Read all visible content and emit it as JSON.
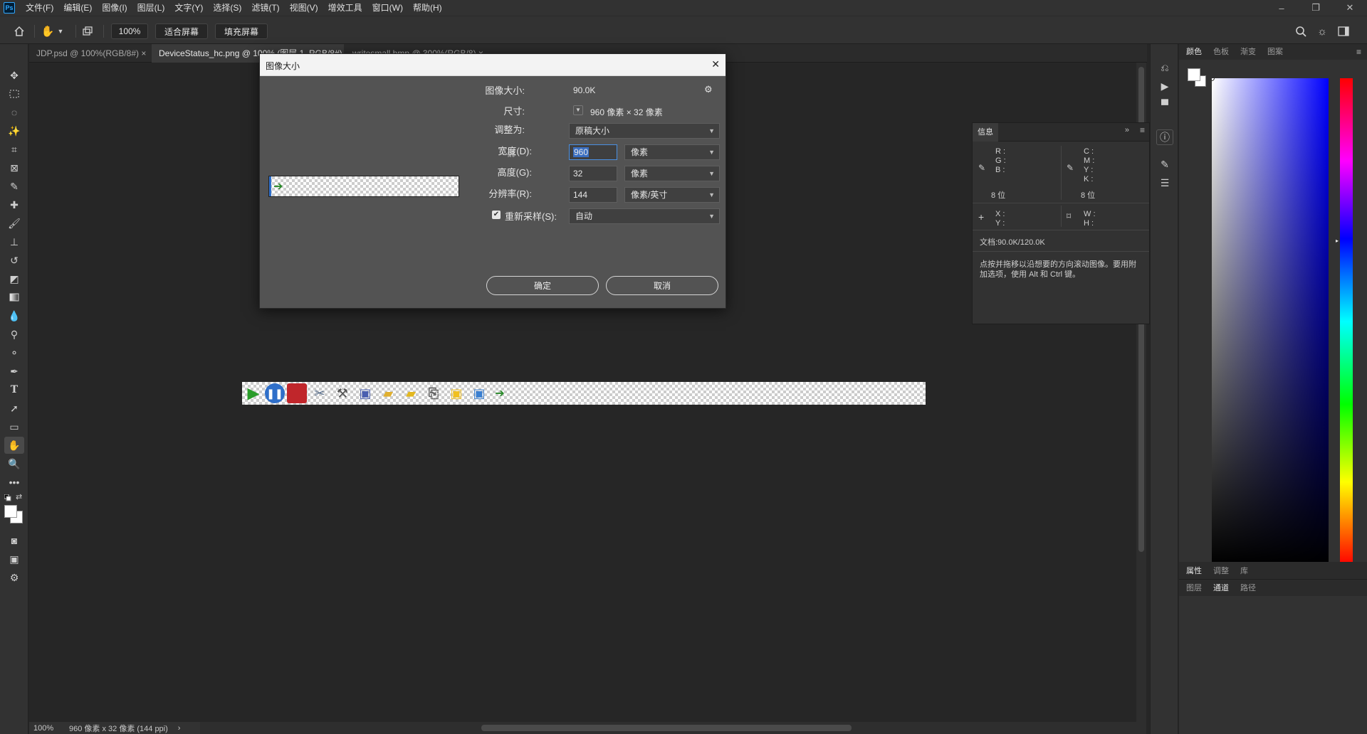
{
  "app": {
    "logo": "Ps"
  },
  "menu": [
    "文件(F)",
    "编辑(E)",
    "图像(I)",
    "图层(L)",
    "文字(Y)",
    "选择(S)",
    "滤镜(T)",
    "视图(V)",
    "增效工具",
    "窗口(W)",
    "帮助(H)"
  ],
  "window_controls": {
    "minimize": "–",
    "restore": "❐",
    "close": "✕"
  },
  "options": {
    "zoom": "100%",
    "fit_screen": "适合屏幕",
    "fill_screen": "填充屏幕"
  },
  "tabs": [
    {
      "label": "JDP.psd @ 100%(RGB/8#)",
      "close": "×"
    },
    {
      "label": "DeviceStatus_hc.png @ 100% (图层 1, RGB/8#)",
      "close": "×"
    },
    {
      "label": "writesmall.bmp @ 300%(RGB/8)",
      "close": "×"
    }
  ],
  "status": {
    "zoom": "100%",
    "doc_info": "960 像素 x 32 像素 (144 ppi)",
    "arrow": "›"
  },
  "dialog": {
    "title": "图像大小",
    "close": "✕",
    "image_size_label": "图像大小:",
    "image_size_value": "90.0K",
    "dimensions_label": "尺寸:",
    "dimensions_value": "960 像素 × 32 像素",
    "fit_to_label": "调整为:",
    "fit_to_value": "原稿大小",
    "width_label": "宽度(D):",
    "width_value": "960",
    "width_unit": "像素",
    "height_label": "高度(G):",
    "height_value": "32",
    "height_unit": "像素",
    "resolution_label": "分辨率(R):",
    "resolution_value": "144",
    "resolution_unit": "像素/英寸",
    "resample_label": "重新采样(S):",
    "resample_value": "自动",
    "resample_checked": true,
    "ok": "确定",
    "cancel": "取消"
  },
  "info_panel": {
    "title": "信息",
    "rgb_labels": "R :\nG :\nB :",
    "cmyk_labels": "C :\nM :\nY :\nK :",
    "bits_left": "8 位",
    "bits_right": "8 位",
    "xy_labels": "X :\nY :",
    "wh_labels": "W :\nH :",
    "doc": "文档:90.0K/120.0K",
    "hint": "点按并拖移以沿想要的方向滚动图像。要用附加选项，使用 Alt 和 Ctrl 键。"
  },
  "color_panel": {
    "tabs": [
      "颜色",
      "色板",
      "渐变",
      "图案"
    ],
    "hue_color": "#0000ff",
    "bottom_tabs_1": [
      "属性",
      "调整",
      "库"
    ],
    "bottom_tabs_2": [
      "图层",
      "通道",
      "路径"
    ]
  }
}
